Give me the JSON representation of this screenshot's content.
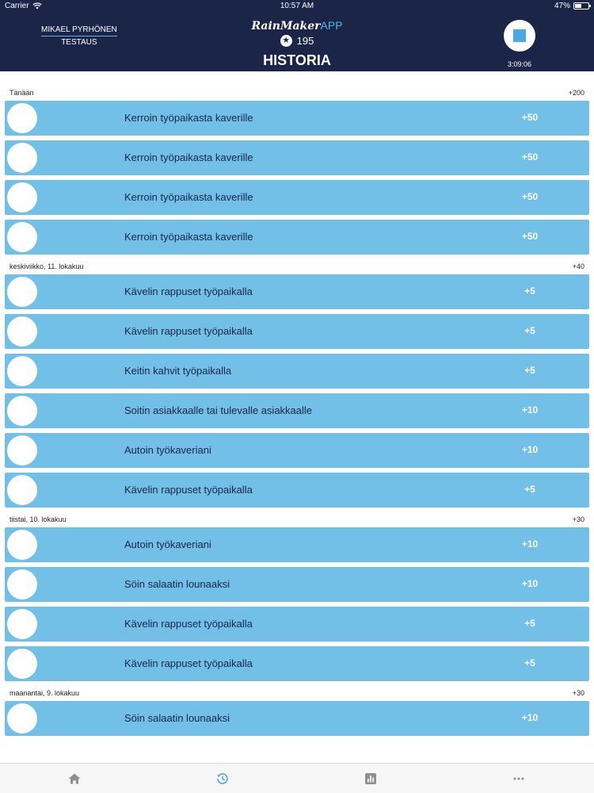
{
  "status": {
    "carrier": "Carrier",
    "time": "10:57 AM",
    "battery_text": "47%",
    "battery_level": 0.47
  },
  "header": {
    "user_name": "MIKAEL PYRHÖNEN",
    "team_name": "TESTAUS",
    "brand_part1": "RainMaker",
    "brand_part2": "APP",
    "points": "195",
    "title": "HISTORIA",
    "timer": "3:09:06"
  },
  "days": [
    {
      "label": "Tänään",
      "total": "+200",
      "items": [
        {
          "title": "Kerroin työpaikasta kaverille",
          "points": "+50"
        },
        {
          "title": "Kerroin työpaikasta kaverille",
          "points": "+50"
        },
        {
          "title": "Kerroin työpaikasta kaverille",
          "points": "+50"
        },
        {
          "title": "Kerroin työpaikasta kaverille",
          "points": "+50"
        }
      ]
    },
    {
      "label": "keskiviikko, 11. lokakuu",
      "total": "+40",
      "items": [
        {
          "title": "Kävelin rappuset työpaikalla",
          "points": "+5"
        },
        {
          "title": "Kävelin rappuset työpaikalla",
          "points": "+5"
        },
        {
          "title": "Keitin kahvit työpaikalla",
          "points": "+5"
        },
        {
          "title": "Soitin asiakkaalle tai tulevalle asiakkaalle",
          "points": "+10"
        },
        {
          "title": "Autoin työkaveriani",
          "points": "+10"
        },
        {
          "title": "Kävelin rappuset työpaikalla",
          "points": "+5"
        }
      ]
    },
    {
      "label": "tiistai, 10. lokakuu",
      "total": "+30",
      "items": [
        {
          "title": "Autoin työkaveriani",
          "points": "+10"
        },
        {
          "title": "Söin salaatin lounaaksi",
          "points": "+10"
        },
        {
          "title": "Kävelin rappuset työpaikalla",
          "points": "+5"
        },
        {
          "title": "Kävelin rappuset työpaikalla",
          "points": "+5"
        }
      ]
    },
    {
      "label": "maanantai, 9. lokakuu",
      "total": "+30",
      "items": [
        {
          "title": "Söin salaatin lounaaksi",
          "points": "+10"
        }
      ]
    }
  ],
  "tabs": [
    {
      "name": "home",
      "icon": "home-icon"
    },
    {
      "name": "history",
      "icon": "history-icon",
      "active": true
    },
    {
      "name": "stats",
      "icon": "bar-chart-icon"
    },
    {
      "name": "more",
      "icon": "more-icon"
    }
  ],
  "colors": {
    "header_bg": "#1a2548",
    "row_bg": "#72c0e8",
    "accent": "#4aa8e2",
    "tab_active": "#4aa8e2",
    "tab_inactive": "#8e8e93"
  }
}
